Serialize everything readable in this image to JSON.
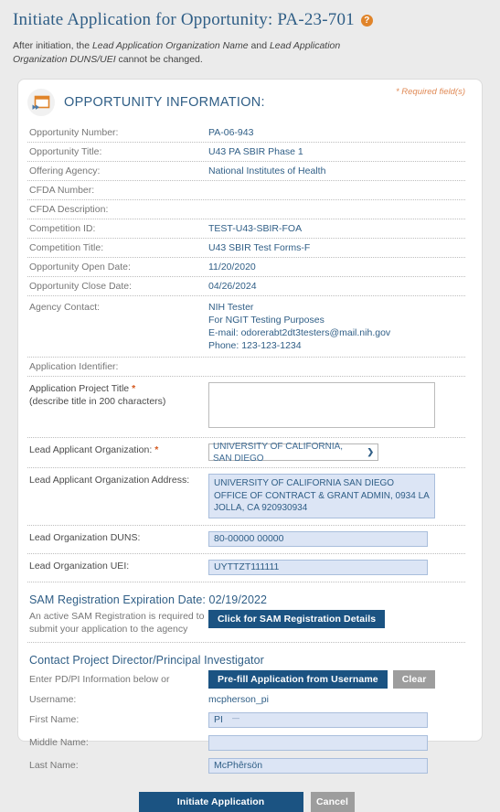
{
  "page": {
    "title": "Initiate Application for Opportunity: PA-23-701",
    "help_icon": "help-question-icon",
    "note_prefix": "After initiation, the ",
    "note_em1": "Lead Application Organization Name",
    "note_mid": " and ",
    "note_em2": "Lead Application Organization DUNS/UEI",
    "note_suffix": " cannot be changed."
  },
  "section": {
    "icon": "form-window-icon",
    "title": "OPPORTUNITY INFORMATION:",
    "required_note": "* Required field(s)"
  },
  "opportunity": {
    "rows": [
      {
        "label": "Opportunity Number:",
        "value": "PA-06-943"
      },
      {
        "label": "Opportunity Title:",
        "value": "U43 PA SBIR Phase 1"
      },
      {
        "label": "Offering Agency:",
        "value": "National Institutes of Health"
      },
      {
        "label": "CFDA Number:",
        "value": ""
      },
      {
        "label": "CFDA Description:",
        "value": ""
      },
      {
        "label": "Competition ID:",
        "value": "TEST-U43-SBIR-FOA"
      },
      {
        "label": "Competition Title:",
        "value": "U43 SBIR Test Forms-F"
      },
      {
        "label": "Opportunity Open Date:",
        "value": "11/20/2020"
      },
      {
        "label": "Opportunity Close Date:",
        "value": "04/26/2024"
      }
    ],
    "agency_contact": {
      "label": "Agency Contact:",
      "lines": [
        "NIH Tester",
        "For NGIT Testing Purposes",
        "E-mail: odorerabt2dt3testers@mail.nih.gov",
        "Phone: 123-123-1234"
      ]
    },
    "app_identifier": {
      "label": "Application Identifier:",
      "value": ""
    }
  },
  "form": {
    "project_title": {
      "label_line1": "Application Project Title",
      "label_star": "*",
      "label_line2": "(describe title in 200 characters)",
      "value": "",
      "placeholder": ""
    },
    "lead_org": {
      "label": "Lead Applicant Organization:",
      "label_star": "*",
      "selected": "UNIVERSITY OF CALIFORNIA, SAN DIEGO",
      "caret_icon": "chevron-down-icon"
    },
    "lead_org_address": {
      "label": "Lead Applicant Organization Address:",
      "lines": [
        "UNIVERSITY OF CALIFORNIA SAN DIEGO",
        "OFFICE OF CONTRACT & GRANT ADMIN, 0934",
        "LA JOLLA, CA 920930934"
      ]
    },
    "duns": {
      "label": "Lead Organization DUNS:",
      "value": "80-00000 00000"
    },
    "uei": {
      "label": "Lead Organization UEI:",
      "value": "UYTTZT111111"
    }
  },
  "sam": {
    "heading": "SAM Registration Expiration Date: 02/19/2022",
    "note_line1": "An active SAM Registration is required to",
    "note_line2": "submit your application to the agency",
    "details_button": "Click for SAM Registration Details"
  },
  "pdpi": {
    "heading": "Contact Project Director/Principal Investigator",
    "enter_label": "Enter PD/PI Information below or",
    "prefill_button": "Pre-fill Application from Username",
    "clear_button": "Clear",
    "username_label": "Username:",
    "username_value": "mcpherson_pi",
    "first_name_label": "First Name:",
    "first_name_value": "PI",
    "middle_name_label": "Middle Name:",
    "middle_name_value": "",
    "last_name_label": "Last Name:",
    "last_name_value": "McPhêrsön"
  },
  "footer": {
    "initiate_button": "Initiate Application",
    "cancel_button": "Cancel"
  },
  "colors": {
    "accent_blue": "#2f5e86",
    "button_blue": "#1b5382",
    "required_orange": "#d4591f",
    "field_fill": "#dce5f5"
  }
}
